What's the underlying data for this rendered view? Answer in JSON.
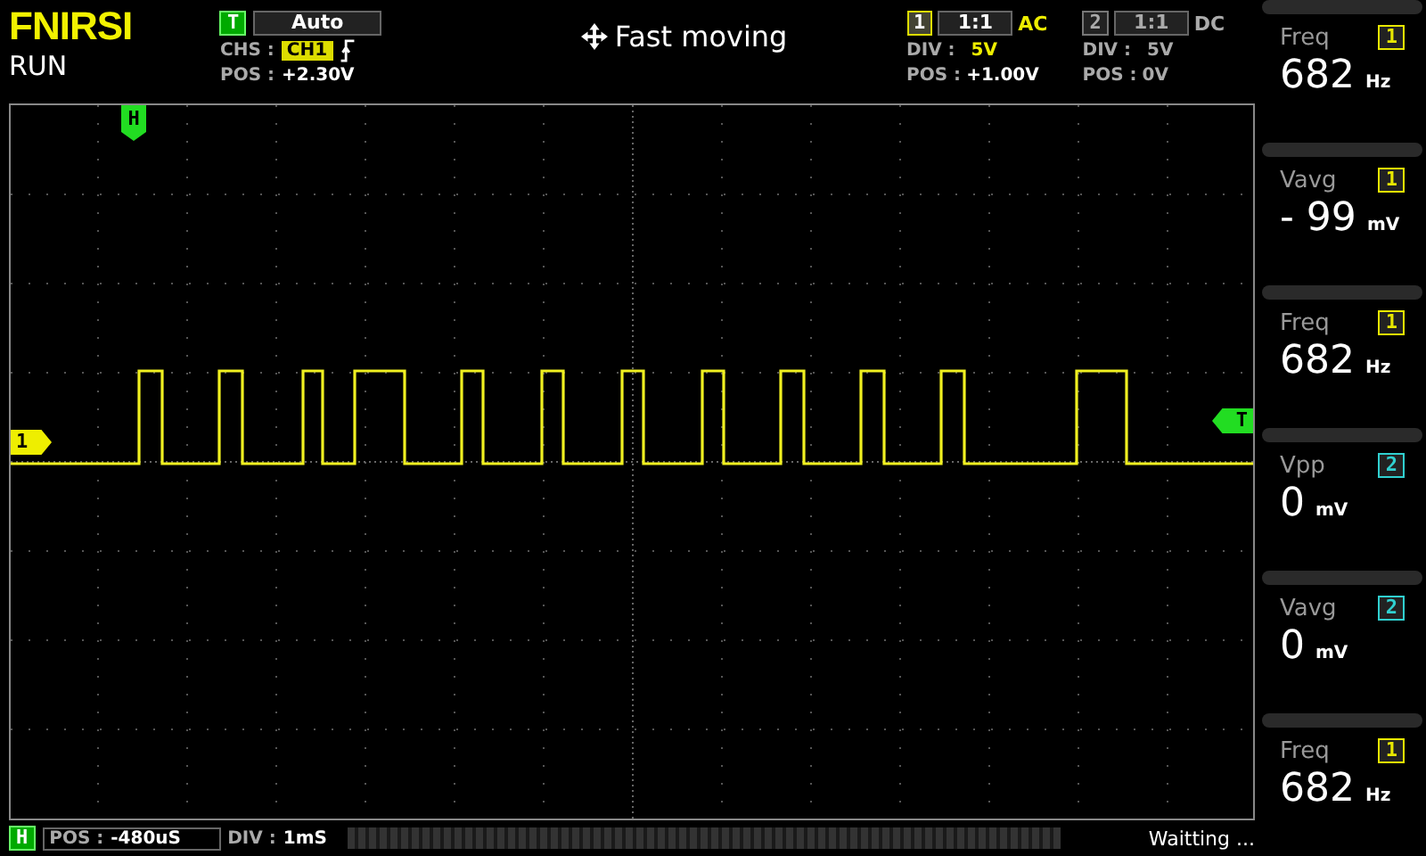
{
  "brand": "FNIRSI",
  "run_state": "RUN",
  "trigger": {
    "badge": "T",
    "mode": "Auto",
    "source_label": "CHS :",
    "source": "CH1",
    "pos_label": "POS :",
    "pos": "+2.30V"
  },
  "move_mode": "Fast moving",
  "channels": [
    {
      "number": "1",
      "probe": "1:1",
      "coupling": "AC",
      "enabled": true,
      "div_label": "DIV :",
      "div": "5V",
      "pos_label": "POS :",
      "pos": "+1.00V"
    },
    {
      "number": "2",
      "probe": "1:1",
      "coupling": "DC",
      "enabled": false,
      "div_label": "DIV :",
      "div": "5V",
      "pos_label": "POS :",
      "pos": "0V"
    }
  ],
  "markers": {
    "horizontal": "H",
    "channel": "1",
    "trigger": "T"
  },
  "measurements": [
    {
      "name": "Freq",
      "channel": "1",
      "color": "#e8e800",
      "value": "682",
      "unit": "Hz"
    },
    {
      "name": "Vavg",
      "channel": "1",
      "color": "#e8e800",
      "value": "- 99",
      "unit": "mV"
    },
    {
      "name": "Freq",
      "channel": "1",
      "color": "#e8e800",
      "value": "682",
      "unit": "Hz"
    },
    {
      "name": "Vpp",
      "channel": "2",
      "color": "#30d0d0",
      "value": "0",
      "unit": "mV"
    },
    {
      "name": "Vavg",
      "channel": "2",
      "color": "#30d0d0",
      "value": "0",
      "unit": "mV"
    },
    {
      "name": "Freq",
      "channel": "1",
      "color": "#e8e800",
      "value": "682",
      "unit": "Hz"
    }
  ],
  "bottom": {
    "badge": "H",
    "pos_label": "POS :",
    "pos": "-480uS",
    "div_label": "DIV :",
    "div": "1mS",
    "status": "Waitting ..."
  }
}
